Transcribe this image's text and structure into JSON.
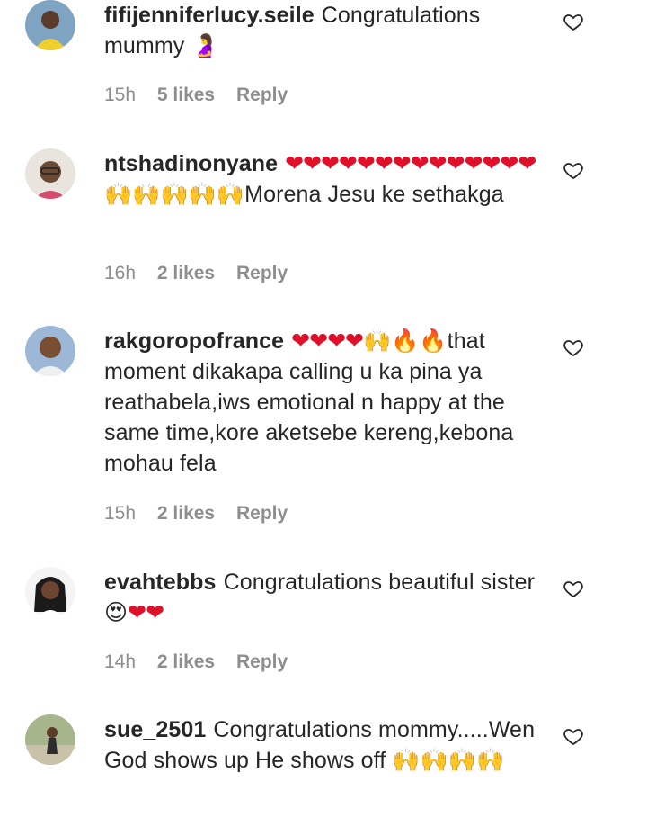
{
  "comments": [
    {
      "username": "fifijenniferlucy.seile",
      "text": "Congratulations mummy",
      "emoji": "🤰",
      "time": "15h",
      "likes": "5 likes",
      "reply": "Reply",
      "avatar": "avatar-woman-yellow-top"
    },
    {
      "username": "ntshadinonyane",
      "hearts": "❤❤❤❤❤❤❤❤❤❤❤❤❤❤",
      "hands": "🙌🙌🙌🙌🙌",
      "text": "Morena Jesu ke sethakga",
      "time": "16h",
      "likes": "2 likes",
      "reply": "Reply",
      "avatar": "avatar-woman-glasses"
    },
    {
      "username": "rakgoropofrance",
      "hearts": "❤❤❤❤",
      "hands": "🙌",
      "fire": "🔥🔥",
      "text": "that moment dikakapa calling u ka pina ya reathabela,iws emotional n happy at the same time,kore aketsebe kereng,kebona mohau fela",
      "time": "15h",
      "likes": "2 likes",
      "reply": "Reply",
      "avatar": "avatar-man-smiling"
    },
    {
      "username": "evahtebbs",
      "text": "Congratulations beautiful sister",
      "emoji": "😍",
      "hearts": "❤❤",
      "time": "14h",
      "likes": "2 likes",
      "reply": "Reply",
      "avatar": "avatar-woman-long-hair"
    },
    {
      "username": "sue_2501",
      "text": "Congratulations mommy.....Wen God shows up He shows off",
      "hands": "🙌🙌🙌🙌",
      "avatar": "avatar-person-outdoors"
    }
  ],
  "icons": {
    "like": "heart-outline-icon"
  },
  "colors": {
    "username": "#262626",
    "meta": "#8e8e8e",
    "heart": "#e0102a"
  }
}
